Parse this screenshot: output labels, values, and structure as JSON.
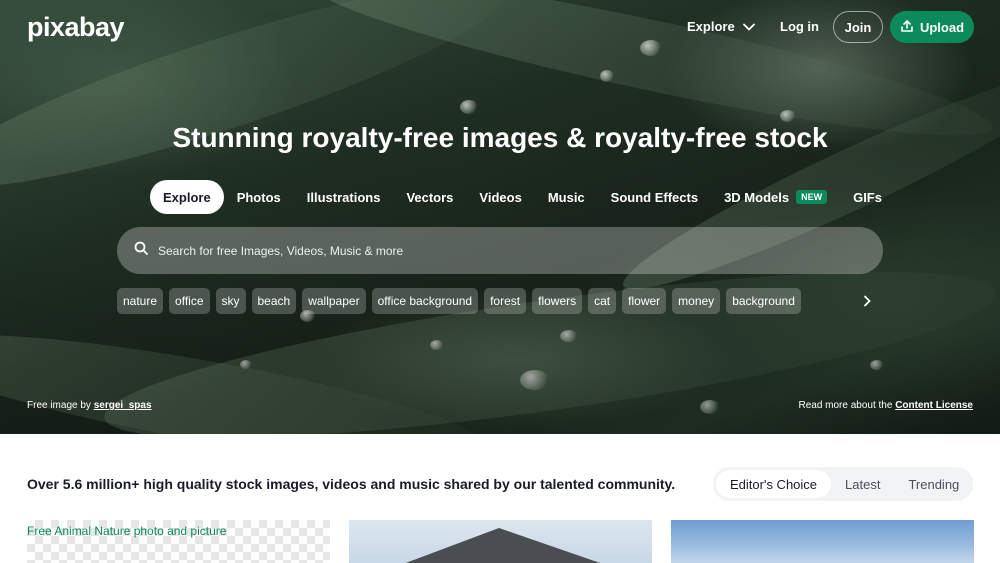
{
  "brand": {
    "logo_text": "pixabay"
  },
  "header": {
    "explore_label": "Explore",
    "login_label": "Log in",
    "join_label": "Join",
    "upload_label": "Upload"
  },
  "hero": {
    "headline": "Stunning royalty-free images & royalty-free stock",
    "tabs": [
      {
        "label": "Explore",
        "active": true
      },
      {
        "label": "Photos"
      },
      {
        "label": "Illustrations"
      },
      {
        "label": "Vectors"
      },
      {
        "label": "Videos"
      },
      {
        "label": "Music"
      },
      {
        "label": "Sound Effects"
      },
      {
        "label": "3D Models",
        "badge": "NEW"
      },
      {
        "label": "GIFs"
      }
    ],
    "search": {
      "placeholder": "Search for free Images, Videos, Music & more"
    },
    "chips": [
      "nature",
      "office",
      "sky",
      "beach",
      "wallpaper",
      "office background",
      "forest",
      "flowers",
      "cat",
      "flower",
      "money",
      "background"
    ],
    "credit": {
      "prefix": "Free image by",
      "author": "sergei_spas"
    },
    "license": {
      "prefix": "Read more about the",
      "link": "Content License"
    }
  },
  "main": {
    "tagline": "Over 5.6 million+ high quality stock images, videos and music shared by our talented community.",
    "sort_options": [
      "Editor's Choice",
      "Latest",
      "Trending"
    ],
    "active_sort": "Editor's Choice",
    "first_card_caption": "Free Animal Nature photo and picture"
  },
  "colors": {
    "accent": "#0b8a5c",
    "text_dark": "#191b26"
  },
  "icons": [
    "chevron-down-icon",
    "upload-icon",
    "search-icon",
    "chevron-right-icon"
  ]
}
